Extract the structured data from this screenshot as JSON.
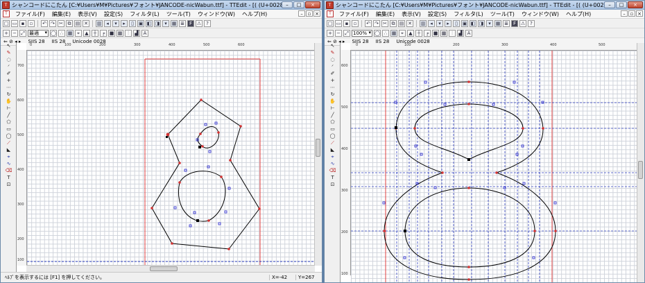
{
  "left_window": {
    "title": "シャンコードにこたん [C:¥Users¥M¥Pictures¥フォント¥JANCODE-nicWabun.ttf] - TTEdit - [( (U+0028)]",
    "menus": [
      "ファイル(F)",
      "編集(E)",
      "表示(V)",
      "設定(S)",
      "フィルタ(L)",
      "ツール(T)",
      "ウィンドウ(W)",
      "ヘルプ(H)"
    ],
    "zoom": "最適",
    "code_info": {
      "sjis": "SJIS 28",
      "jis": "JIS 28",
      "unicode": "Unicode 0028"
    },
    "status_message": "ﾍﾙﾌﾟを表示するには [F1] を押してください。",
    "x_coord": "X=-42",
    "y_coord": "Y=267"
  },
  "right_window": {
    "title": "シャンコードにこたん [C:¥Users¥M¥Pictures¥フォント¥JANCODE-nicWabun.ttf] - TTEdit - [( (U+0028)]",
    "menus": [
      "ファイル(F)",
      "編集(E)",
      "表示(V)",
      "設定(S)",
      "フィルタ(L)",
      "ツール(T)",
      "ウィンドウ(W)",
      "ヘルプ(H)"
    ],
    "zoom": "100%",
    "code_info": {
      "sjis": "SJIS 28",
      "jis": "JIS 28",
      "unicode": "Unicode 0028"
    }
  },
  "window_buttons": {
    "minimize": "–",
    "maximize": "□",
    "close": "×"
  },
  "icons": [
    "arrow-icon",
    "pen-icon",
    "rotate-icon",
    "zoom-icon",
    "undo-icon",
    "redo-icon",
    "cut-icon",
    "copy-icon",
    "paste-icon",
    "delete-icon",
    "font-icon",
    "warning-icon",
    "help-icon"
  ],
  "colors": {
    "guide_red": "#e04040",
    "guide_blue": "#3040c0",
    "outline": "#000000",
    "on_point": "#d33333",
    "off_point": "#2222cc"
  },
  "rulers": {
    "left_top": [
      "0",
      "100",
      "200",
      "300",
      "400",
      "500",
      "600"
    ],
    "right_top": [
      "0",
      "100",
      "200",
      "300",
      "400",
      "500"
    ],
    "left_side": [
      "700",
      "600",
      "500",
      "400",
      "300",
      "200",
      "100"
    ],
    "right_side": [
      "600",
      "500",
      "400",
      "300",
      "200",
      "100"
    ]
  }
}
